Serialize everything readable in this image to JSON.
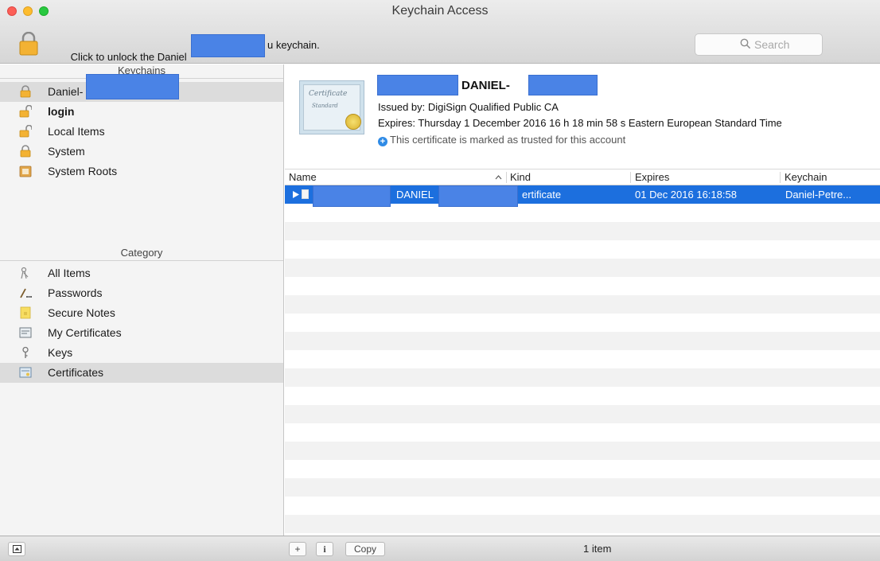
{
  "window": {
    "title": "Keychain Access"
  },
  "toolbar": {
    "unlock_prefix": "Click to unlock the Daniel",
    "unlock_suffix": "u keychain.",
    "search_placeholder": "Search"
  },
  "sidebar": {
    "keychains_header": "Keychains",
    "keychains": [
      {
        "label": "Daniel-",
        "icon": "lock-icon",
        "selected": true,
        "bold": false
      },
      {
        "label": "login",
        "icon": "unlocked-lock-icon",
        "selected": false,
        "bold": true
      },
      {
        "label": "Local Items",
        "icon": "unlocked-lock-icon",
        "selected": false,
        "bold": false
      },
      {
        "label": "System",
        "icon": "lock-icon",
        "selected": false,
        "bold": false
      },
      {
        "label": "System Roots",
        "icon": "cabinet-icon",
        "selected": false,
        "bold": false
      }
    ],
    "category_header": "Category",
    "categories": [
      {
        "label": "All Items",
        "icon": "all-items-icon",
        "selected": false
      },
      {
        "label": "Passwords",
        "icon": "passwords-icon",
        "selected": false
      },
      {
        "label": "Secure Notes",
        "icon": "note-icon",
        "selected": false
      },
      {
        "label": "My Certificates",
        "icon": "certificate-icon",
        "selected": false
      },
      {
        "label": "Keys",
        "icon": "key-icon",
        "selected": false
      },
      {
        "label": "Certificates",
        "icon": "certificate-icon",
        "selected": true
      }
    ]
  },
  "cert_summary": {
    "name": "DANIEL-",
    "issued_by": "Issued by: DigiSign Qualified Public CA",
    "expires": "Expires: Thursday 1 December 2016 16 h 18 min 58 s Eastern European Standard Time",
    "trust": "This certificate is marked as trusted for this account",
    "image_text_1": "Certificate",
    "image_text_2": "Standard"
  },
  "table": {
    "columns": {
      "name": "Name",
      "kind": "Kind",
      "expires": "Expires",
      "keychain": "Keychain"
    },
    "rows": [
      {
        "name": "DANIEL",
        "kind": "ertificate",
        "expires": "01 Dec 2016 16:18:58",
        "keychain": "Daniel-Petre..."
      }
    ]
  },
  "bottombar": {
    "copy_label": "Copy",
    "info_label": "i",
    "add_label": "+",
    "status": "1 item"
  },
  "colors": {
    "selection": "#1c6fde",
    "redaction": "#4a83e6"
  }
}
